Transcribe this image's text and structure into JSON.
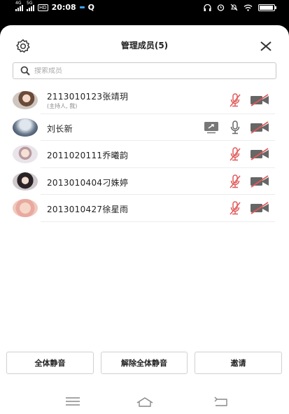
{
  "status_bar": {
    "signal1": "4G",
    "signal2": "5G",
    "hd": "HD",
    "time": "20:08",
    "app": "Q",
    "battery_percent": 95
  },
  "header": {
    "title": "管理成员(5)"
  },
  "search": {
    "placeholder": "搜索成员"
  },
  "members": [
    {
      "name": "2113010123张靖玥",
      "sub": "(主持人, 我)",
      "mic": "muted",
      "camera": "off",
      "share": false
    },
    {
      "name": "刘长新",
      "sub": "",
      "mic": "on",
      "camera": "off",
      "share": true
    },
    {
      "name": "2011020111乔曦韵",
      "sub": "",
      "mic": "muted",
      "camera": "off",
      "share": false
    },
    {
      "name": "2013010404刁姝婷",
      "sub": "",
      "mic": "muted",
      "camera": "off",
      "share": false
    },
    {
      "name": "2013010427徐星雨",
      "sub": "",
      "mic": "muted",
      "camera": "off",
      "share": false
    }
  ],
  "buttons": {
    "mute_all": "全体静音",
    "unmute_all": "解除全体静音",
    "invite": "邀请"
  },
  "colors": {
    "muted_red": "#e05a5a",
    "icon_gray": "#666666"
  }
}
